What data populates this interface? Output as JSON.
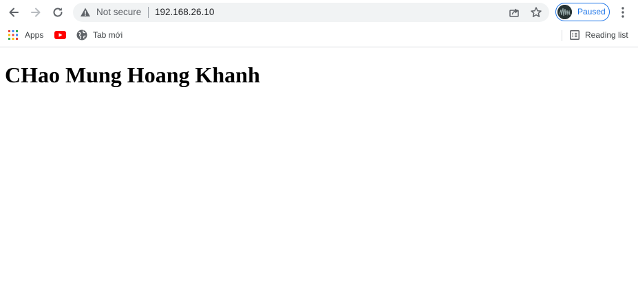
{
  "browser": {
    "security_label": "Not secure",
    "url": "192.168.26.10",
    "profile_status": "Paused",
    "icons": [
      "back-arrow-icon",
      "forward-arrow-icon",
      "reload-icon",
      "warning-icon",
      "share-icon",
      "star-icon",
      "kebab-menu-icon"
    ]
  },
  "bookmarks": {
    "items": [
      {
        "label": "Apps",
        "icon": "apps-grid-icon"
      },
      {
        "label": "",
        "icon": "youtube-icon"
      },
      {
        "label": "Tab mới",
        "icon": "globe-icon"
      }
    ],
    "reading_list": "Reading list"
  },
  "page": {
    "heading": "CHao Mung Hoang Khanh"
  },
  "colors": {
    "accent": "#1a73e8",
    "omnibox": "#f1f3f4",
    "youtube": "#ff0000"
  }
}
